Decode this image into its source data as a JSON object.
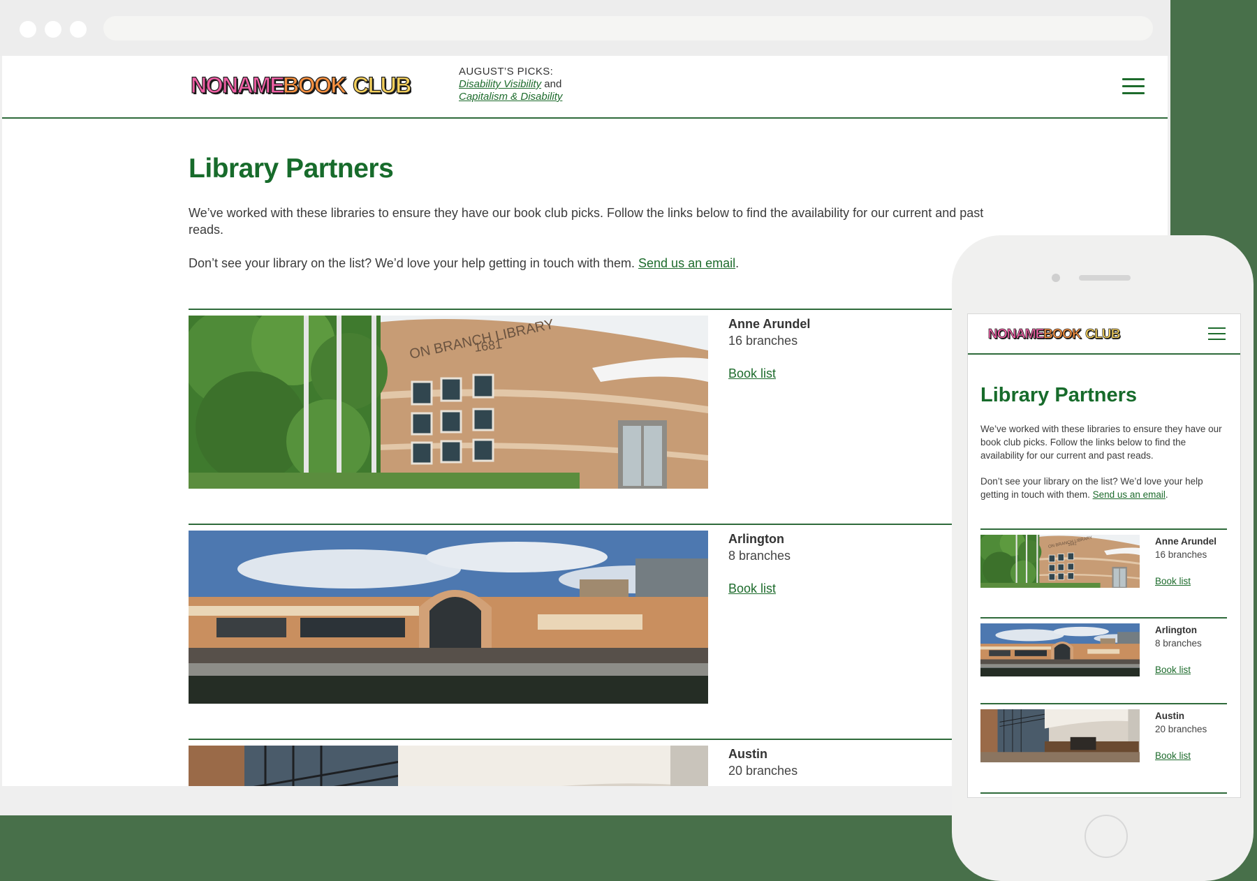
{
  "brand": {
    "logo_text": "NONAME BOOK CLUB",
    "colors": {
      "green": "#1d6b2c",
      "pink": "#ee5fa4",
      "orange": "#f59040",
      "yellow": "#f4d05c"
    }
  },
  "header": {
    "picks_label": "AUGUST’S PICKS:",
    "pick1": "Disability Visibility",
    "joiner": "and",
    "pick2": "Capitalism & Disability",
    "menu_icon": "hamburger-menu-icon"
  },
  "main": {
    "title": "Library Partners",
    "intro": "We’ve worked with these libraries to ensure they have our book club picks. Follow the links below to find the availability for our current and past reads.",
    "cta_text": "Don’t see your library on the list? We’d love your help getting in touch with them. ",
    "cta_link": "Send us an email",
    "cta_end": "."
  },
  "libraries": [
    {
      "name": "Anne Arundel",
      "branches": "16 branches",
      "link": "Book list",
      "sign": "ON BRANCH LIBRARY",
      "number": "1681"
    },
    {
      "name": "Arlington",
      "branches": "8 branches",
      "link": "Book list"
    },
    {
      "name": "Austin",
      "branches": "20 branches",
      "link": "Book list"
    }
  ]
}
